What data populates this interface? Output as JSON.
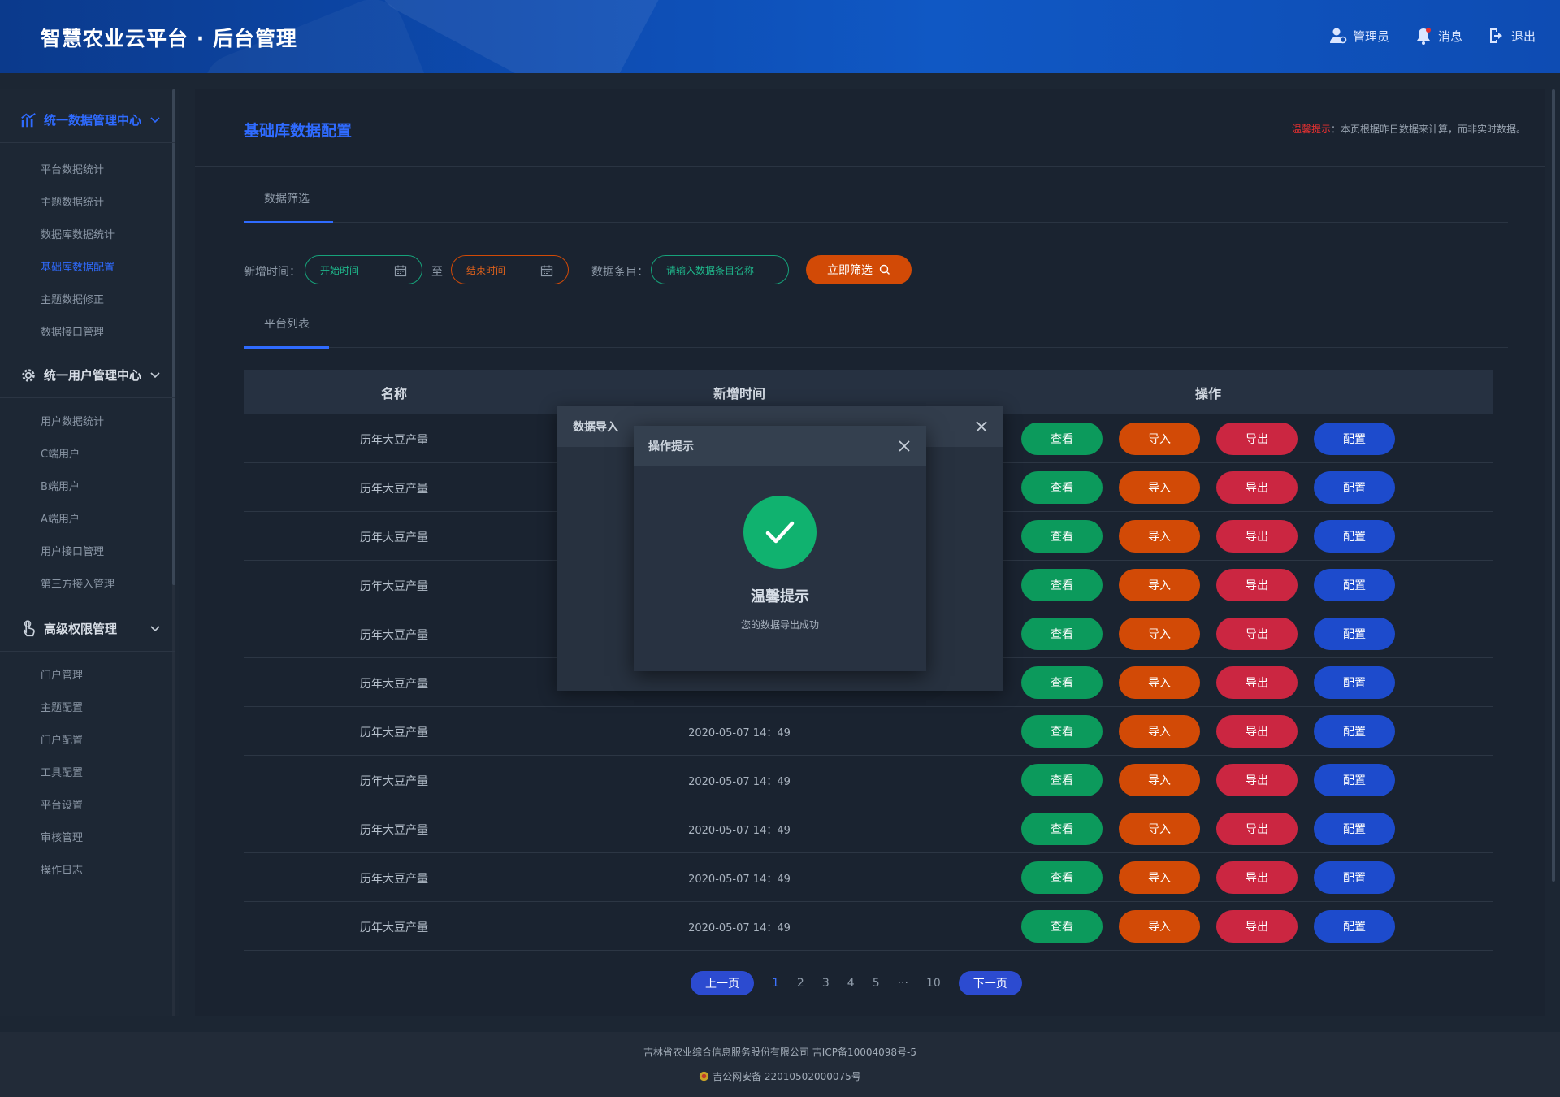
{
  "header": {
    "title": "智慧农业云平台 · 后台管理",
    "nav": [
      {
        "label": "管理员",
        "icon": "user-admin-icon"
      },
      {
        "label": "消息",
        "icon": "bell-icon"
      },
      {
        "label": "退出",
        "icon": "logout-icon"
      }
    ]
  },
  "sidebar": {
    "groups": [
      {
        "title": "统一数据管理中心",
        "icon": "chart-icon",
        "active": true,
        "items": [
          "平台数据统计",
          "主题数据统计",
          "数据库数据统计",
          "基础库数据配置",
          "主题数据修正",
          "数据接口管理"
        ],
        "active_item": 3
      },
      {
        "title": "统一用户管理中心",
        "icon": "gear-icon",
        "active": false,
        "items": [
          "用户数据统计",
          "C端用户",
          "B端用户",
          "A端用户",
          "用户接口管理",
          "第三方接入管理"
        ]
      },
      {
        "title": "高级权限管理",
        "icon": "finger-touch-icon",
        "active": false,
        "items": [
          "门户管理",
          "主题配置",
          "门户配置",
          "工具配置",
          "平台设置",
          "审核管理",
          "操作日志"
        ]
      }
    ]
  },
  "main": {
    "page_title": "基础库数据配置",
    "tip_label": "温馨提示",
    "tip_text": "：本页根据昨日数据来计算，而非实时数据。",
    "tab_filter": "数据筛选",
    "filter": {
      "time_label": "新增时间：",
      "start_placeholder": "开始时间",
      "to": "至",
      "end_placeholder": "结束时间",
      "item_label": "数据条目：",
      "item_placeholder": "请输入数据条目名称",
      "search_btn": "立即筛选"
    },
    "tab_list": "平台列表",
    "table": {
      "headers": [
        "名称",
        "新增时间",
        "操作"
      ],
      "actions": [
        "查看",
        "导入",
        "导出",
        "配置"
      ],
      "rows": [
        {
          "name": "历年大豆产量",
          "time": ""
        },
        {
          "name": "历年大豆产量",
          "time": ""
        },
        {
          "name": "历年大豆产量",
          "time": ""
        },
        {
          "name": "历年大豆产量",
          "time": ""
        },
        {
          "name": "历年大豆产量",
          "time": ""
        },
        {
          "name": "历年大豆产量",
          "time": ""
        },
        {
          "name": "历年大豆产量",
          "time": "2020-05-07  14：49"
        },
        {
          "name": "历年大豆产量",
          "time": "2020-05-07  14：49"
        },
        {
          "name": "历年大豆产量",
          "time": "2020-05-07  14：49"
        },
        {
          "name": "历年大豆产量",
          "time": "2020-05-07  14：49"
        },
        {
          "name": "历年大豆产量",
          "time": "2020-05-07  14：49"
        }
      ]
    },
    "pager": {
      "prev": "上一页",
      "pages": [
        "1",
        "2",
        "3",
        "4",
        "5",
        "···",
        "10"
      ],
      "current": "1",
      "next": "下一页"
    }
  },
  "footer": {
    "line1": "吉林省农业综合信息服务股份有限公司    吉ICP备10004098号-5",
    "line2": "吉公网安备 22010502000075号"
  },
  "dialog_import": {
    "title": "数据导入"
  },
  "dialog_tip": {
    "title": "操作提示",
    "heading": "温馨提示",
    "message": "您的数据导出成功"
  },
  "colors": {
    "accent": "#2f6bff",
    "view": "#0c9a5c",
    "import": "#d24a06",
    "export": "#cb2641",
    "config": "#1d4bcc",
    "success": "#10b26f"
  }
}
